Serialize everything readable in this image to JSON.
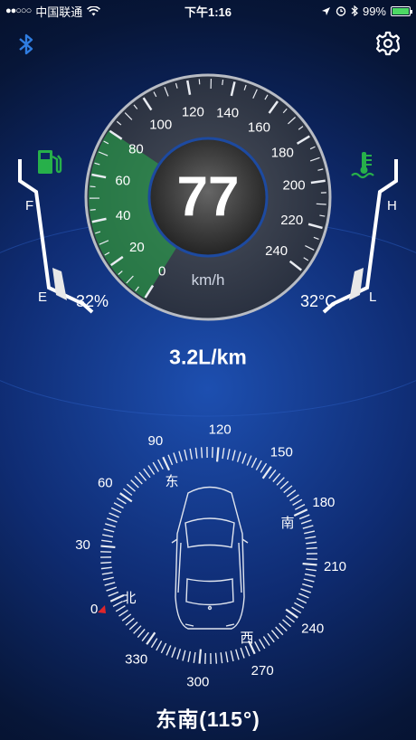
{
  "status_bar": {
    "signal_dots": "●●○○○",
    "carrier": "中国联通",
    "time": "下午1:16",
    "battery_text": "99%",
    "battery_level": 0.99
  },
  "speedometer": {
    "speed": "77",
    "unit": "km/h",
    "scale_labels": [
      "0",
      "20",
      "40",
      "60",
      "80",
      "100",
      "120",
      "140",
      "160",
      "180",
      "200",
      "220",
      "240"
    ],
    "highlight_max": 80
  },
  "fuel": {
    "full_label": "F",
    "empty_label": "E",
    "percent": "32%"
  },
  "temperature": {
    "high_label": "H",
    "low_label": "L",
    "value": "32°C"
  },
  "fuel_economy": "3.2L/km",
  "compass": {
    "degree_labels": [
      "0",
      "30",
      "60",
      "90",
      "120",
      "150",
      "180",
      "210",
      "240",
      "270",
      "300",
      "330"
    ],
    "direction_labels": {
      "north": "北",
      "east": "东",
      "south": "南",
      "west": "西"
    },
    "heading_text": "东南(115°)"
  },
  "colors": {
    "accent_green": "#27b04a",
    "bluetooth_blue": "#2f7de1",
    "marker_red": "#e0262a"
  }
}
